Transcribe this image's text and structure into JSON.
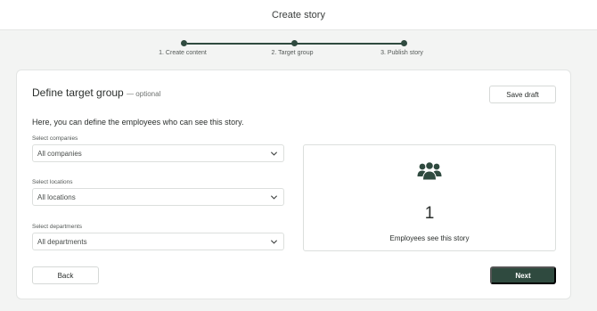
{
  "header": {
    "title": "Create story"
  },
  "stepper": {
    "steps": [
      {
        "label": "1. Create content"
      },
      {
        "label": "2. Target group"
      },
      {
        "label": "3. Publish story"
      }
    ]
  },
  "card": {
    "title": "Define target group",
    "optional_label": "— optional",
    "save_draft_label": "Save draft",
    "intro": "Here, you can define the employees who can see this story.",
    "fields": [
      {
        "label": "Select companies",
        "value": "All companies"
      },
      {
        "label": "Select locations",
        "value": "All locations"
      },
      {
        "label": "Select departments",
        "value": "All departments"
      }
    ],
    "stat": {
      "icon": "users-icon",
      "count": "1",
      "label": "Employees see this story"
    },
    "back_label": "Back",
    "next_label": "Next"
  },
  "colors": {
    "accent": "#2f4a3f",
    "background": "#f3f4f3",
    "border": "#dcdfdd"
  }
}
